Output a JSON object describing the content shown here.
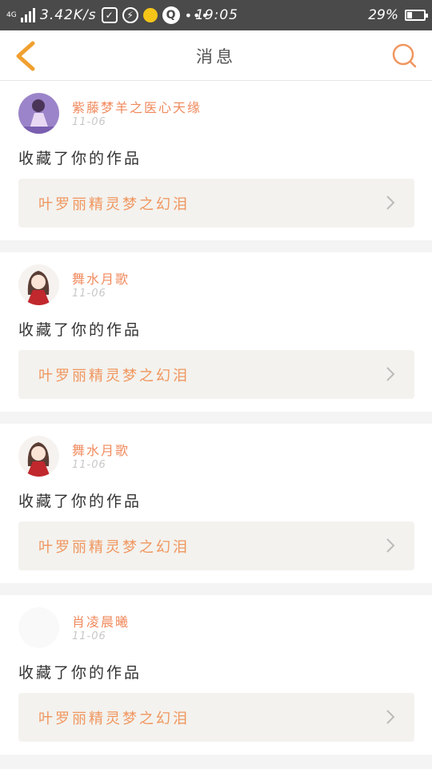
{
  "status_bar": {
    "network_type": "4G",
    "speed": "3.42K/s",
    "time": "19:05",
    "battery": "29%",
    "battery_level": 0.29
  },
  "nav": {
    "title": "消息",
    "back_icon": "chevron-left-icon",
    "search_icon": "search-icon",
    "accent_color": "#f0a030"
  },
  "messages": [
    {
      "user": "紫藤梦羊之医心天缘",
      "date": "11-06",
      "action": "收藏了你的作品",
      "work_title": "叶罗丽精灵梦之幻泪",
      "avatar": "purple-dress-avatar"
    },
    {
      "user": "舞水月歌",
      "date": "11-06",
      "action": "收藏了你的作品",
      "work_title": "叶罗丽精灵梦之幻泪",
      "avatar": "anime-girl-avatar"
    },
    {
      "user": "舞水月歌",
      "date": "11-06",
      "action": "收藏了你的作品",
      "work_title": "叶罗丽精灵梦之幻泪",
      "avatar": "anime-girl-avatar"
    },
    {
      "user": "肖凌晨曦",
      "date": "11-06",
      "action": "收藏了你的作品",
      "work_title": "叶罗丽精灵梦之幻泪",
      "avatar": "blank-avatar"
    }
  ]
}
